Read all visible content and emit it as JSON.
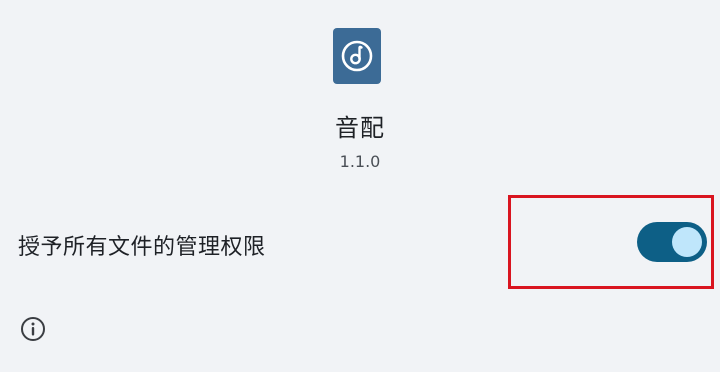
{
  "app": {
    "name": "音配",
    "version": "1.1.0",
    "icon": "music-note-logo-icon",
    "icon_color": "#3c6b96"
  },
  "permission": {
    "label": "授予所有文件的管理权限",
    "enabled": true,
    "switch_color": "#0d5f86",
    "thumb_color": "#bfe6fb"
  },
  "highlight": {
    "color": "#d9141f"
  },
  "footer": {
    "icon": "info-icon"
  }
}
